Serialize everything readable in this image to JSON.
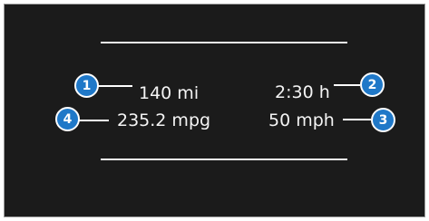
{
  "trip_display": {
    "distance": "140 mi",
    "time": "2:30 h",
    "consumption": "235.2 mpg",
    "speed": "50 mph"
  },
  "callouts": {
    "c1": "1",
    "c2": "2",
    "c3": "3",
    "c4": "4"
  },
  "colors": {
    "screen_bg": "#1b1b1b",
    "text": "#f4f4f4",
    "callout_fill": "#1f78c8",
    "callout_border": "#ffffff"
  }
}
